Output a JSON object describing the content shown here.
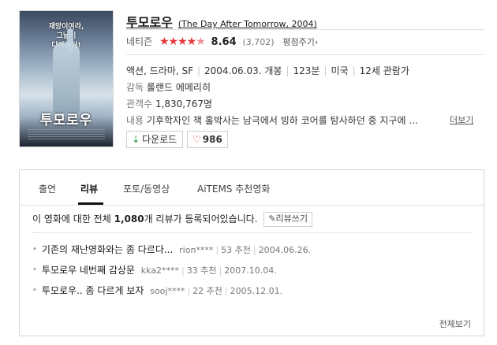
{
  "movie": {
    "title_kr": "투모로우",
    "title_en": "(The Day After Tomorrow, 2004)",
    "poster": {
      "tagline": [
        "재앙이여라,",
        "그날이",
        "다가온다!"
      ],
      "title": "투모로우"
    },
    "rating": {
      "label": "네티즌",
      "stars": "4.5 of 5",
      "score": "8.64",
      "count": "(3,702)",
      "rate_label": "평점주기"
    },
    "info": {
      "genre": "액션, 드라마, SF",
      "release": "2004.06.03. 개봉",
      "runtime": "123분",
      "country": "미국",
      "age": "12세 관람가",
      "director_label": "감독",
      "director": "롤랜드 에메리히",
      "audience_label": "관객수",
      "audience": "1,830,767명",
      "plot_label": "내용",
      "plot": "기후학자인 잭 홀박사는 남극에서 빙하 코어를 탐사하던 중 지구에 ...",
      "more_label": "더보기"
    },
    "buttons": {
      "download": "다운로드",
      "like_count": "986"
    }
  },
  "tabs": [
    {
      "label": "출연",
      "active": false
    },
    {
      "label": "리뷰",
      "active": true
    },
    {
      "label": "포토/동영상",
      "active": false
    },
    {
      "label": "AiTEMS 추천영화",
      "active": false
    }
  ],
  "reviews": {
    "summary_prefix": "이 영화에 대한 전체 ",
    "summary_count": "1,080",
    "summary_suffix": "개 리뷰가 등록되어있습니다.",
    "write_label": "리뷰쓰기",
    "items": [
      {
        "title": "기존의 재난영화와는 좀 다르다...",
        "author": "rion****",
        "votes": "53 추천",
        "date": "2004.06.26."
      },
      {
        "title": "투모로우 네번째 감상문",
        "author": "kka2****",
        "votes": "33 추천",
        "date": "2007.10.04."
      },
      {
        "title": "투모로우.. 좀 다르게 보자",
        "author": "sooj****",
        "votes": "22 추천",
        "date": "2005.12.01."
      }
    ],
    "all_label": "전체보기"
  },
  "colors": {
    "star": "#e5383b",
    "download_icon": "#3aa35a",
    "border": "#d9d9d9"
  }
}
